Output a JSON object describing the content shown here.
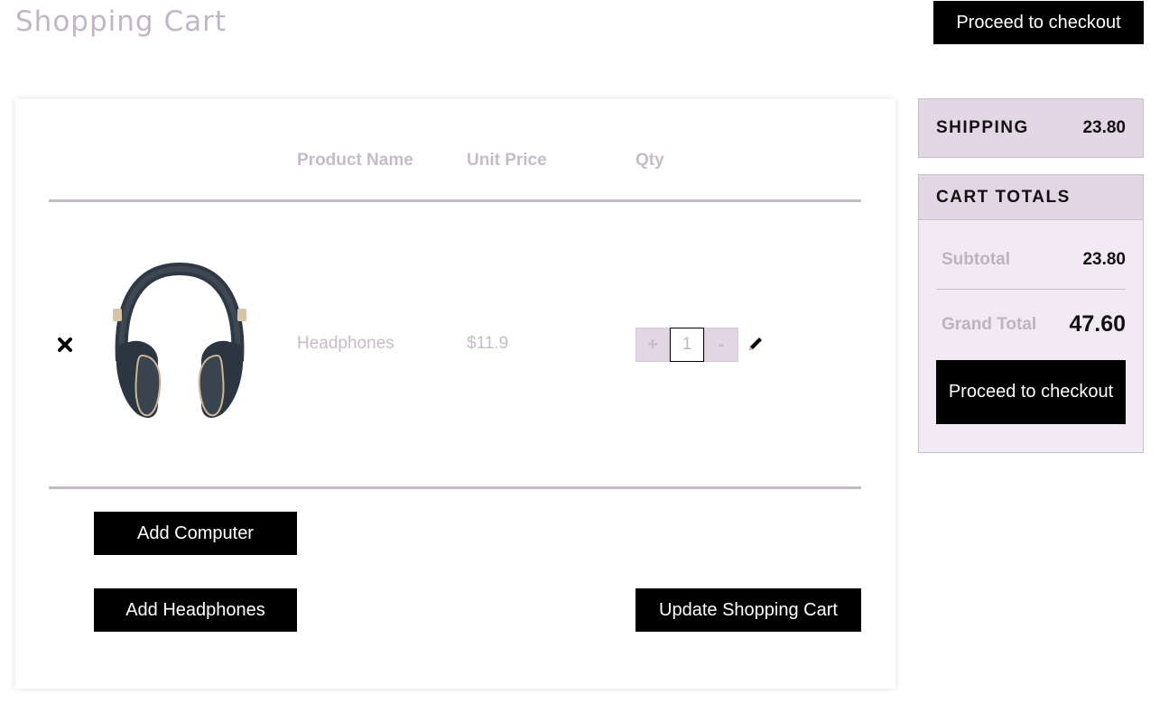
{
  "page": {
    "title": "Shopping Cart",
    "top_checkout_label": "Proceed to checkout"
  },
  "table": {
    "headers": {
      "product_name": "Product Name",
      "unit_price": "Unit Price",
      "qty": "Qty"
    },
    "rows": [
      {
        "image_icon": "headphones-image",
        "name": "Headphones",
        "price": "$11.9",
        "qty": "1",
        "plus_label": "+",
        "minus_label": "-"
      }
    ]
  },
  "actions": {
    "add_computer": "Add Computer",
    "add_headphones": "Add Headphones",
    "update_cart": "Update Shopping Cart"
  },
  "shipping": {
    "label": "SHIPPING",
    "value": "23.80"
  },
  "totals": {
    "heading": "CART TOTALS",
    "subtotal_label": "Subtotal",
    "subtotal_value": "23.80",
    "grand_total_label": "Grand Total",
    "grand_total_value": "47.60",
    "checkout_label": "Proceed to checkout"
  },
  "icons": {
    "remove": "close-icon",
    "edit": "pencil-icon"
  },
  "colors": {
    "accent_panel": "#e2d6e4",
    "panel_light": "#f1eaf2",
    "muted_text": "#c6bcc9",
    "button": "#000000"
  }
}
